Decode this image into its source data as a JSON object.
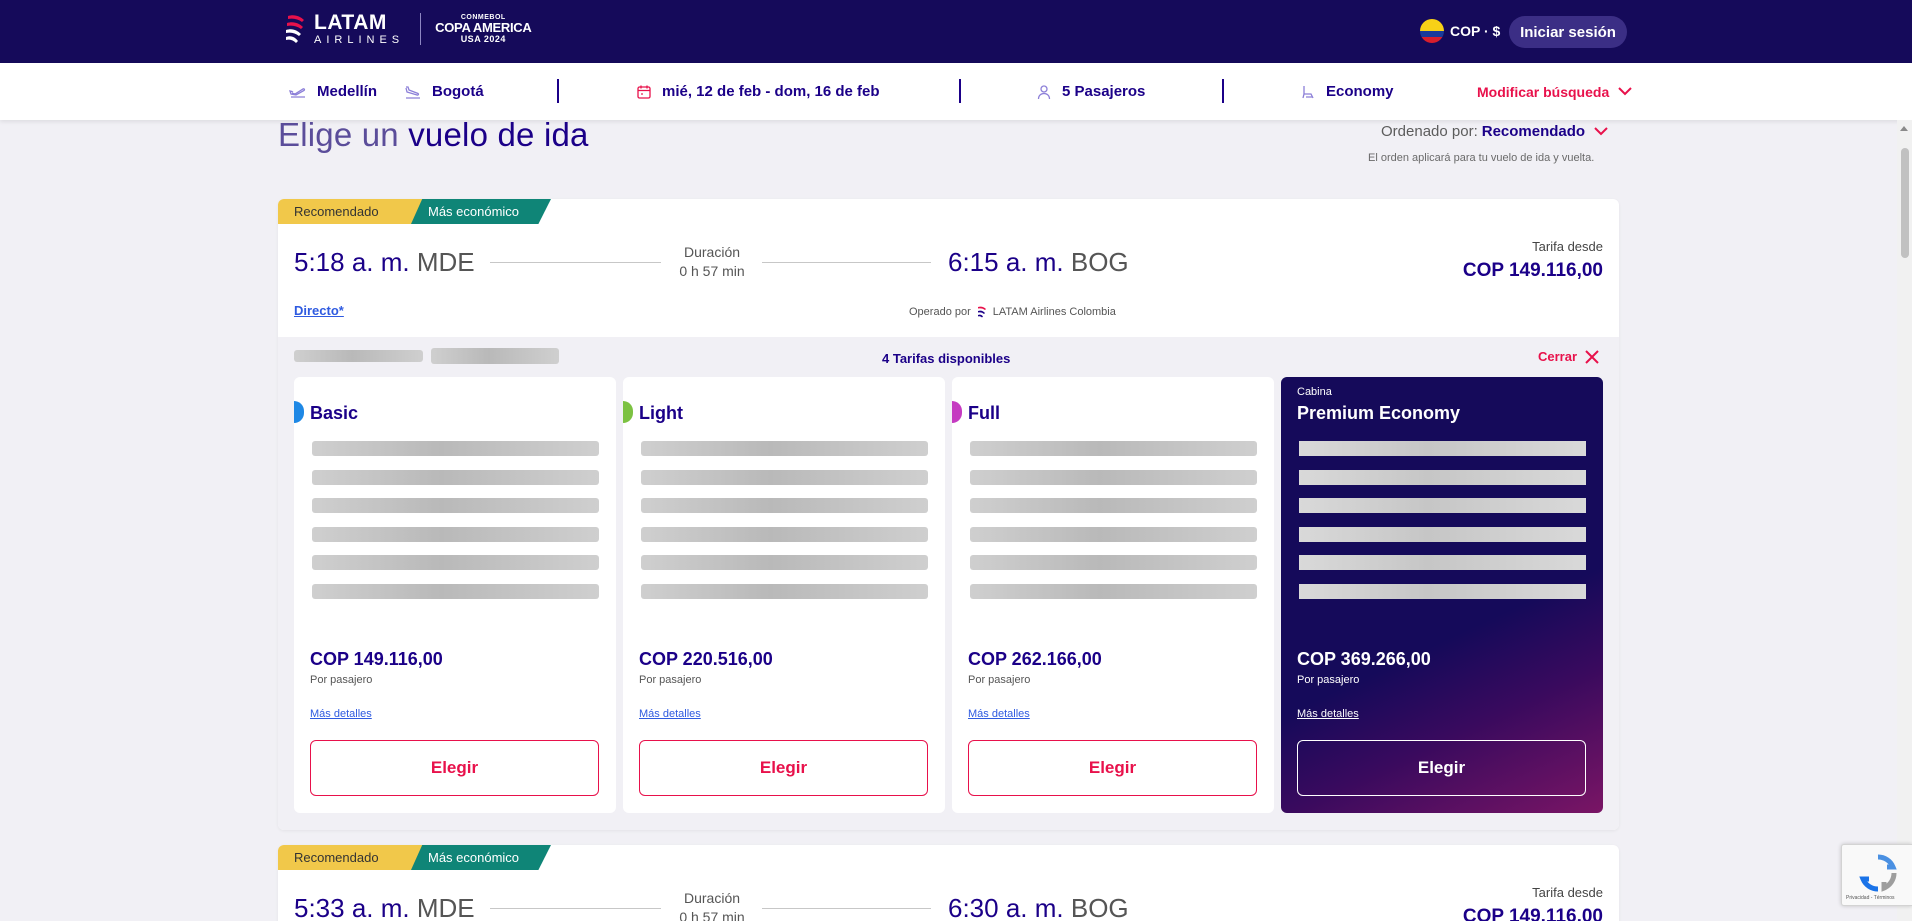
{
  "header": {
    "logo_main": "LATAM",
    "logo_sub": "AIRLINES",
    "partner_top": "CONMEBOL",
    "partner_main": "COPA AMERICA",
    "partner_sub": "USA 2024",
    "currency": "COP · $",
    "login_label": "Iniciar sesión"
  },
  "search": {
    "origin": "Medellín",
    "destination": "Bogotá",
    "dates": "mié, 12 de feb - dom, 16 de feb",
    "passengers": "5 Pasajeros",
    "cabin": "Economy",
    "modify_label": "Modificar búsqueda"
  },
  "page": {
    "heading_light": "Elige un",
    "heading_bold": "vuelo de ida",
    "sort_label": "Ordenado por:",
    "sort_value": "Recomendado",
    "sort_note": "El orden aplicará para tu vuelo de ida y vuelta."
  },
  "flights": [
    {
      "badge_recommended": "Recomendado",
      "badge_cheapest": "Más económico",
      "depart_time": "5:18 a. m.",
      "depart_code": "MDE",
      "duration_label": "Duración",
      "duration": "0 h 57 min",
      "arrive_time": "6:15 a. m.",
      "arrive_code": "BOG",
      "fare_from_label": "Tarifa desde",
      "fare_from": "COP 149.116,00",
      "stops": "Directo*",
      "operated_label": "Operado por",
      "operator": "LATAM Airlines Colombia",
      "fares_count": "4 Tarifas disponibles",
      "close_label": "Cerrar",
      "fares": [
        {
          "name": "Basic",
          "price": "COP 149.116,00",
          "per": "Por pasajero",
          "more": "Más detalles",
          "choose": "Elegir",
          "color": "#1e88e5"
        },
        {
          "name": "Light",
          "price": "COP 220.516,00",
          "per": "Por pasajero",
          "more": "Más detalles",
          "choose": "Elegir",
          "color": "#7cc242"
        },
        {
          "name": "Full",
          "price": "COP 262.166,00",
          "per": "Por pasajero",
          "more": "Más detalles",
          "choose": "Elegir",
          "color": "#c53bc1"
        },
        {
          "cabin_label": "Cabina",
          "name": "Premium Economy",
          "price": "COP 369.266,00",
          "per": "Por pasajero",
          "more": "Más detalles",
          "choose": "Elegir"
        }
      ]
    },
    {
      "badge_recommended": "Recomendado",
      "badge_cheapest": "Más económico",
      "depart_time": "5:33 a. m.",
      "depart_code": "MDE",
      "duration_label": "Duración",
      "duration": "0 h 57 min",
      "arrive_time": "6:30 a. m.",
      "arrive_code": "BOG",
      "fare_from_label": "Tarifa desde",
      "fare_from": "COP 149.116,00"
    }
  ],
  "recaptcha": {
    "text": "Privacidad - Términos"
  }
}
